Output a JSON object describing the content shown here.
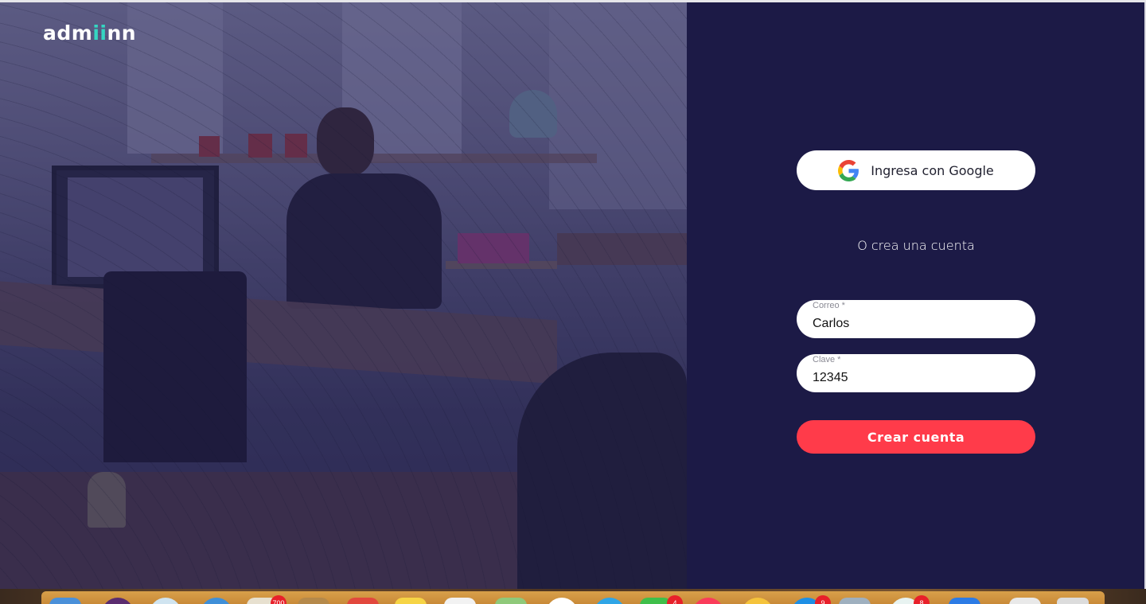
{
  "brand": {
    "logo_prefix": "adm",
    "logo_accent": "ii",
    "logo_suffix": "nn",
    "accent_color": "#35d6c2"
  },
  "auth": {
    "google_button_label": "Ingresa con Google",
    "divider_text": "O crea una cuenta",
    "email": {
      "label": "Correo *",
      "value": "Carlos"
    },
    "password": {
      "label": "Clave *",
      "value": "12345"
    },
    "submit_label": "Crear cuenta"
  },
  "colors": {
    "panel_background": "#1c1a46",
    "primary_button": "#ff3b4a",
    "field_background": "#ffffff"
  },
  "dock": {
    "badges": [
      "700",
      "4",
      "9",
      "8"
    ]
  }
}
